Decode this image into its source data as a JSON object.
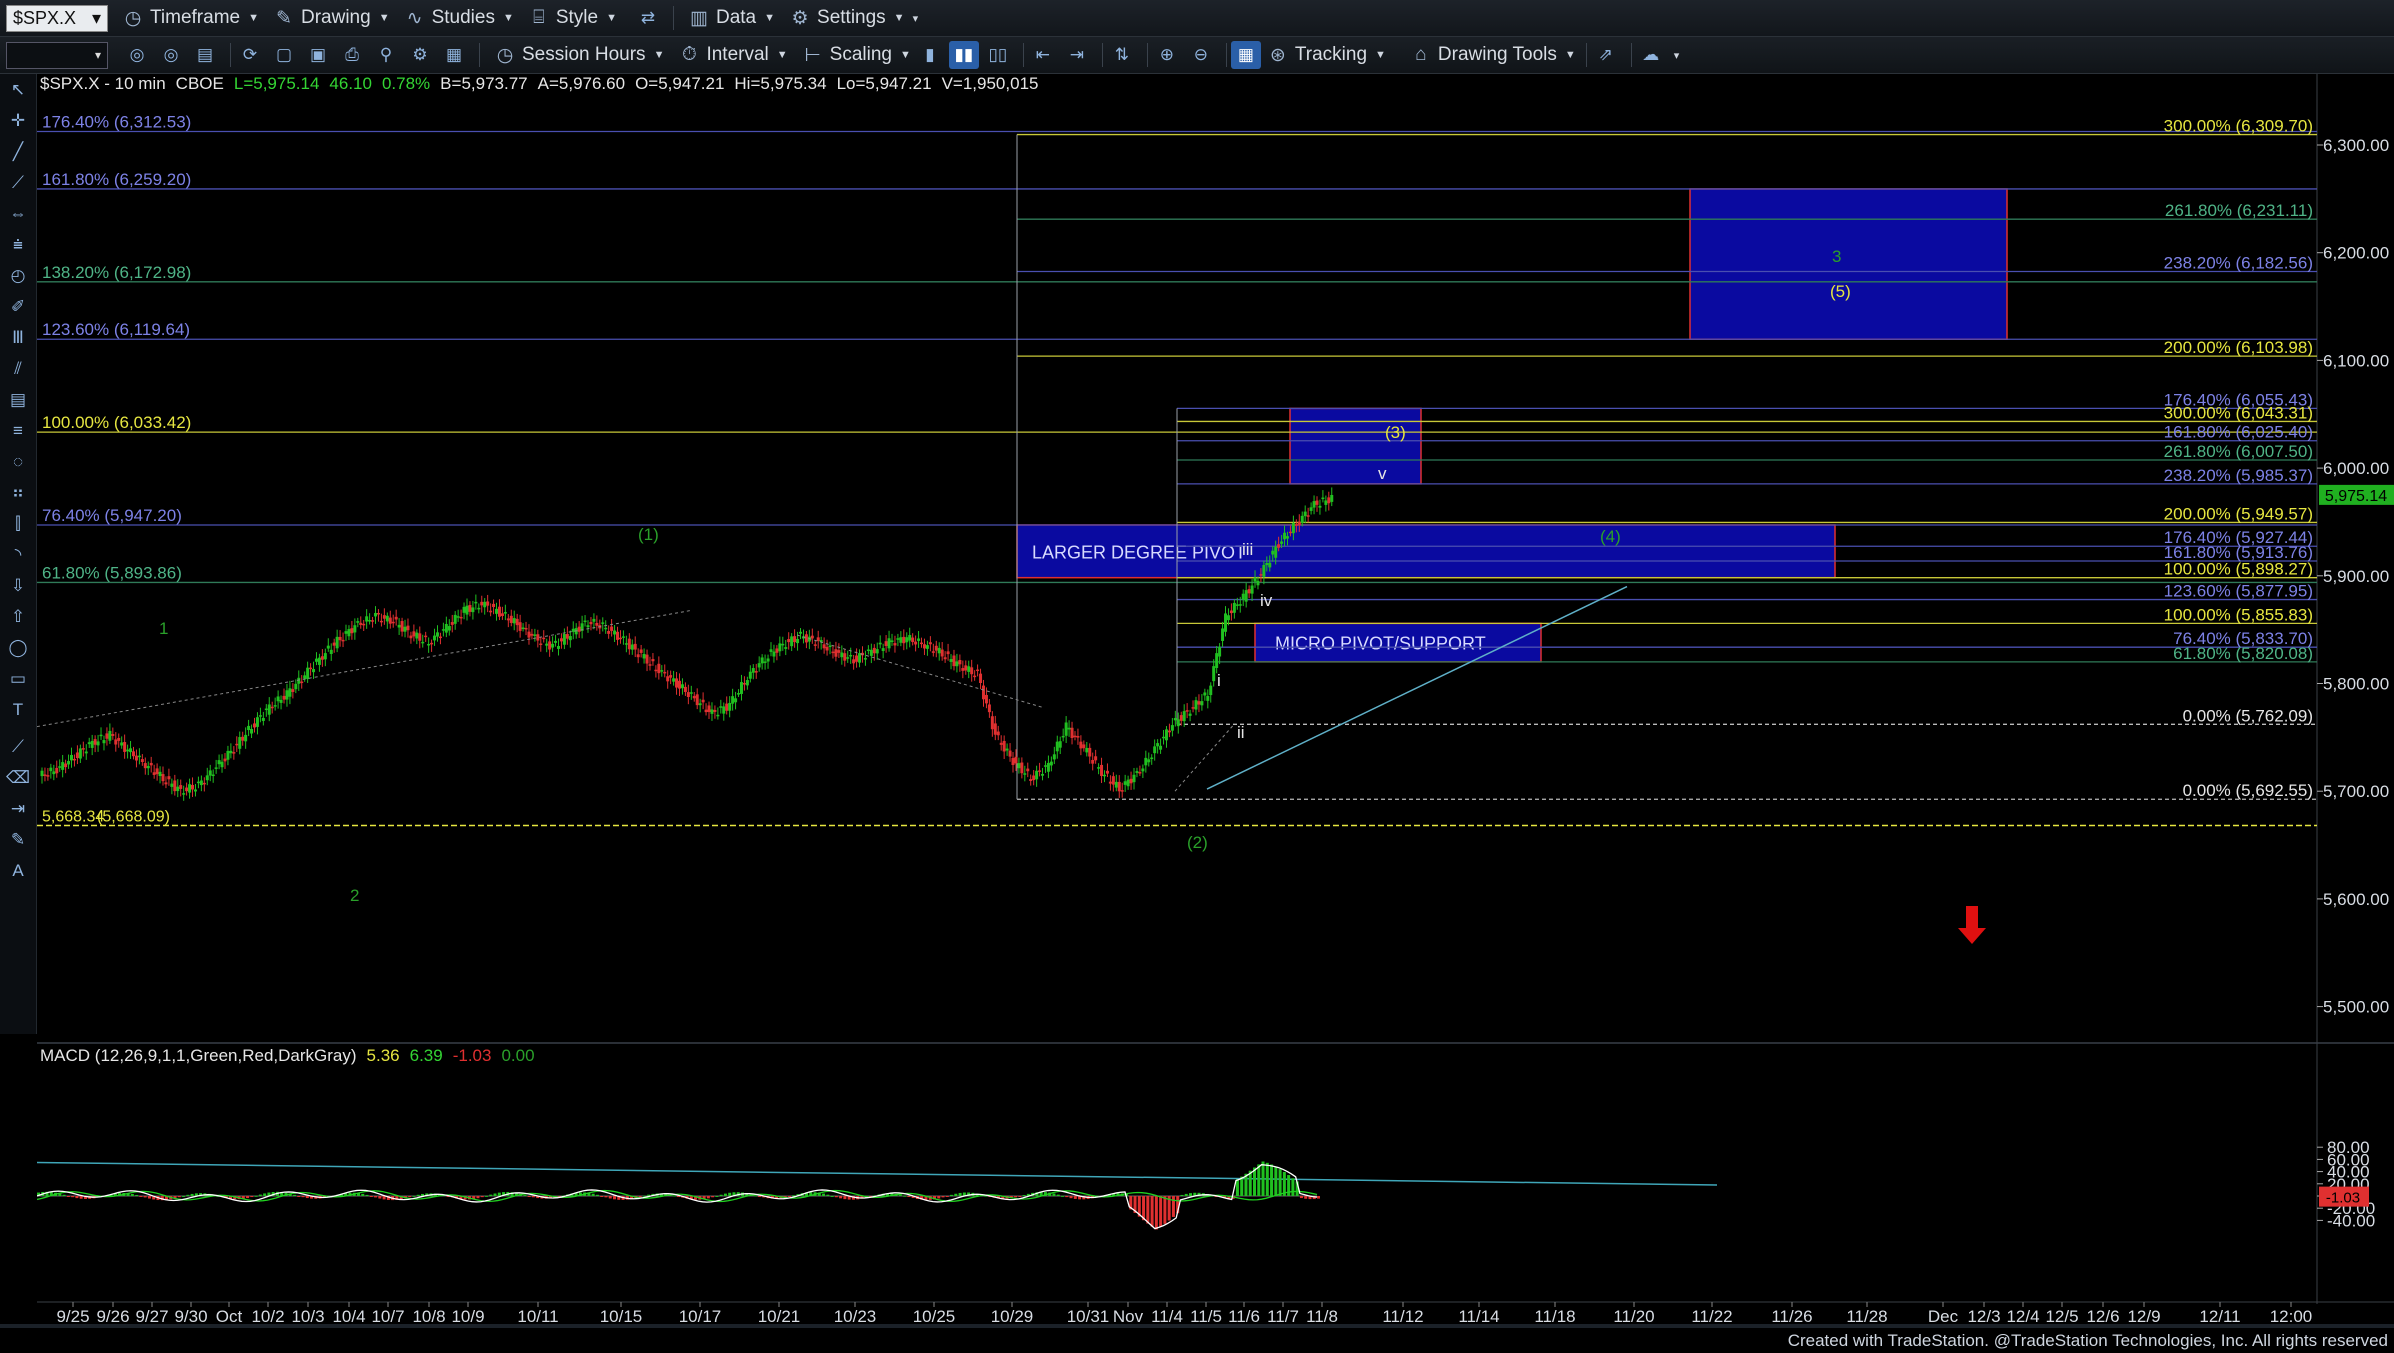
{
  "menu": {
    "symbol": "$SPX.X",
    "items": [
      {
        "label": "Timeframe",
        "icon": "clock-icon"
      },
      {
        "label": "Drawing",
        "icon": "pencil-icon"
      },
      {
        "label": "Studies",
        "icon": "studies-icon"
      },
      {
        "label": "Style",
        "icon": "style-icon"
      },
      {
        "label": "Data",
        "icon": "data-icon"
      },
      {
        "label": "Settings",
        "icon": "gear-icon"
      }
    ]
  },
  "toolbar": {
    "session_hours": "Session Hours",
    "interval": "Interval",
    "scaling": "Scaling",
    "tracking": "Tracking",
    "drawing_tools": "Drawing Tools"
  },
  "legend": {
    "symbol_interval": "$SPX.X - 10 min",
    "exchange": "CBOE",
    "last": "L=5,975.14",
    "change": "46.10",
    "change_pct": "0.78%",
    "bid": "B=5,973.77",
    "ask": "A=5,976.60",
    "open": "O=5,947.21",
    "high": "Hi=5,975.34",
    "low": "Lo=5,947.21",
    "volume": "V=1,950,015"
  },
  "macd_legend": {
    "label": "MACD (12,26,9,1,1,Green,Red,DarkGray)",
    "v1": "5.36",
    "v2": "6.39",
    "v3": "-1.03",
    "v4": "0.00"
  },
  "footer": "Created with TradeStation. @TradeStation Technologies, Inc. All rights reserved",
  "colors": {
    "up": "#20c020",
    "down": "#e03030",
    "fib_blue": "#5a5fc8",
    "fib_yellow": "#e6e640",
    "fib_green": "#3a9a6a",
    "box": "#0a0aa0",
    "macd_line": "#ffffff",
    "macd_signal": "#20d020"
  },
  "chart_data": {
    "type": "candlestick",
    "price_axis": {
      "ticks": [
        "6,300.00",
        "6,200.00",
        "6,100.00",
        "6,000.00",
        "5,900.00",
        "5,800.00",
        "5,700.00",
        "5,600.00",
        "5,500.00"
      ],
      "last_price": "5,975.14"
    },
    "macd_axis": {
      "ticks": [
        "80.00",
        "60.00",
        "40.00",
        "20.00",
        "0.00",
        "-20.00",
        "-40.00"
      ],
      "last_value": "-1.03"
    },
    "date_axis": [
      "9/25",
      "9/26",
      "9/27",
      "9/30",
      "Oct",
      "10/2",
      "10/3",
      "10/4",
      "10/7",
      "10/8",
      "10/9",
      "10/11",
      "10/15",
      "10/17",
      "10/21",
      "10/23",
      "10/25",
      "10/29",
      "10/31",
      "Nov",
      "11/4",
      "11/5",
      "11/6",
      "11/7",
      "11/8",
      "11/12",
      "11/14",
      "11/18",
      "11/20",
      "11/22",
      "11/26",
      "11/28",
      "Dec",
      "12/3",
      "12/4",
      "12/5",
      "12/6",
      "12/9",
      "12/11",
      "12:00"
    ],
    "left_fibs": [
      {
        "label": "176.40% (6,312.53)",
        "value": 6312.53,
        "color": "blue"
      },
      {
        "label": "161.80% (6,259.20)",
        "value": 6259.2,
        "color": "blue"
      },
      {
        "label": "138.20% (6,172.98)",
        "value": 6172.98,
        "color": "green"
      },
      {
        "label": "123.60% (6,119.64)",
        "value": 6119.64,
        "color": "blue"
      },
      {
        "label": "100.00% (6,033.42)",
        "value": 6033.42,
        "color": "yellow"
      },
      {
        "label": "76.40% (5,947.20)",
        "value": 5947.2,
        "color": "blue"
      },
      {
        "label": "61.80% (5,893.86)",
        "value": 5893.86,
        "color": "green"
      },
      {
        "label": "5,668.34",
        "value": 5668.34,
        "color": "yellow"
      },
      {
        "label": "(5,668.09)",
        "value": 5668.09,
        "color": "yellow"
      }
    ],
    "right_fibs": [
      {
        "label": "300.00% (6,309.70)",
        "value": 6309.7,
        "color": "yellow"
      },
      {
        "label": "261.80% (6,231.11)",
        "value": 6231.11,
        "color": "green"
      },
      {
        "label": "238.20% (6,182.56)",
        "value": 6182.56,
        "color": "blue"
      },
      {
        "label": "200.00% (6,103.98)",
        "value": 6103.98,
        "color": "yellow"
      },
      {
        "label": "176.40% (6,055.43)",
        "value": 6055.43,
        "color": "blue"
      },
      {
        "label": "300.00% (6,043.31)",
        "value": 6043.31,
        "color": "yellow"
      },
      {
        "label": "161.80% (6,025.40)",
        "value": 6025.4,
        "color": "blue"
      },
      {
        "label": "261.80% (6,007.50)",
        "value": 6007.5,
        "color": "green"
      },
      {
        "label": "238.20% (5,985.37)",
        "value": 5985.37,
        "color": "blue"
      },
      {
        "label": "200.00% (5,949.57)",
        "value": 5949.57,
        "color": "yellow"
      },
      {
        "label": "176.40% (5,927.44)",
        "value": 5927.44,
        "color": "blue"
      },
      {
        "label": "161.80% (5,913.76)",
        "value": 5913.76,
        "color": "blue"
      },
      {
        "label": "100.00% (5,898.27)",
        "value": 5898.27,
        "color": "yellow"
      },
      {
        "label": "123.60% (5,877.95)",
        "value": 5877.95,
        "color": "blue"
      },
      {
        "label": "100.00% (5,855.83)",
        "value": 5855.83,
        "color": "yellow"
      },
      {
        "label": "76.40% (5,833.70)",
        "value": 5833.7,
        "color": "blue"
      },
      {
        "label": "61.80% (5,820.08)",
        "value": 5820.08,
        "color": "green"
      },
      {
        "label": "0.00% (5,762.09)",
        "value": 5762.09,
        "color": "white"
      },
      {
        "label": "0.00% (5,692.55)",
        "value": 5692.55,
        "color": "white"
      }
    ],
    "zones": [
      {
        "label": "LARGER DEGREE PIVOT",
        "from": 5947.2,
        "to": 5898.27
      },
      {
        "label": "MICRO PIVOT/SUPPORT",
        "from": 5855.83,
        "to": 5820.08
      },
      {
        "label": "",
        "from": 6055.43,
        "to": 5985.37
      },
      {
        "label": "",
        "from": 6259.2,
        "to": 6119.64
      }
    ],
    "wave_labels": [
      "1",
      "2",
      "(1)",
      "(2)",
      "i",
      "ii",
      "iii",
      "iv",
      "v",
      "(3)",
      "(4)",
      "3",
      "(5)"
    ],
    "closes": [
      5720,
      5732,
      5745,
      5752,
      5738,
      5725,
      5712,
      5700,
      5705,
      5722,
      5740,
      5760,
      5778,
      5790,
      5808,
      5826,
      5842,
      5855,
      5862,
      5858,
      5846,
      5838,
      5852,
      5868,
      5874,
      5866,
      5855,
      5842,
      5834,
      5846,
      5858,
      5852,
      5840,
      5826,
      5812,
      5800,
      5786,
      5772,
      5780,
      5806,
      5824,
      5836,
      5844,
      5838,
      5828,
      5822,
      5830,
      5838,
      5842,
      5836,
      5828,
      5816,
      5808,
      5752,
      5728,
      5712,
      5724,
      5760,
      5740,
      5718,
      5702,
      5716,
      5738,
      5762,
      5776,
      5790,
      5862,
      5880,
      5902,
      5930,
      5948,
      5966,
      5972
    ]
  }
}
